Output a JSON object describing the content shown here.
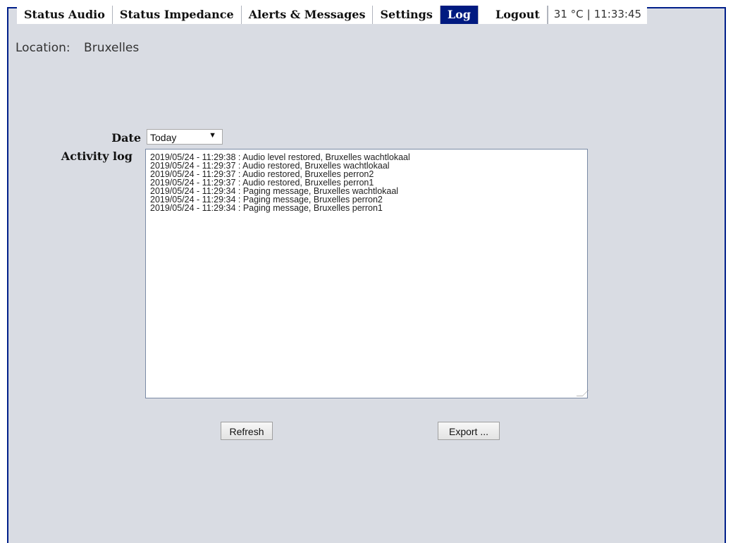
{
  "menu": {
    "items": [
      {
        "label": "Status Audio",
        "active": false
      },
      {
        "label": "Status Impedance",
        "active": false
      },
      {
        "label": "Alerts & Messages",
        "active": false
      },
      {
        "label": "Settings",
        "active": false
      },
      {
        "label": "Log",
        "active": true
      }
    ],
    "logout_label": "Logout"
  },
  "status": {
    "temperature": "31 °C",
    "separator": "|",
    "time": "11:33:45"
  },
  "location": {
    "label": "Location:",
    "value": "Bruxelles"
  },
  "form": {
    "date_label": "Date",
    "date_selected": "Today",
    "log_label": "Activity log"
  },
  "log_entries": [
    "2019/05/24 - 11:29:38 : Audio level restored, Bruxelles wachtlokaal",
    "2019/05/24 - 11:29:37 : Audio restored, Bruxelles wachtlokaal",
    "2019/05/24 - 11:29:37 : Audio restored, Bruxelles perron2",
    "2019/05/24 - 11:29:37 : Audio restored, Bruxelles perron1",
    "2019/05/24 - 11:29:34 : Paging message, Bruxelles wachtlokaal",
    "2019/05/24 - 11:29:34 : Paging message, Bruxelles perron2",
    "2019/05/24 - 11:29:34 : Paging message, Bruxelles perron1"
  ],
  "buttons": {
    "refresh_label": "Refresh",
    "export_label": "Export ..."
  },
  "colors": {
    "active_tab_bg": "#001a80",
    "page_bg": "#d9dce3",
    "frame_border": "#001f8a"
  }
}
